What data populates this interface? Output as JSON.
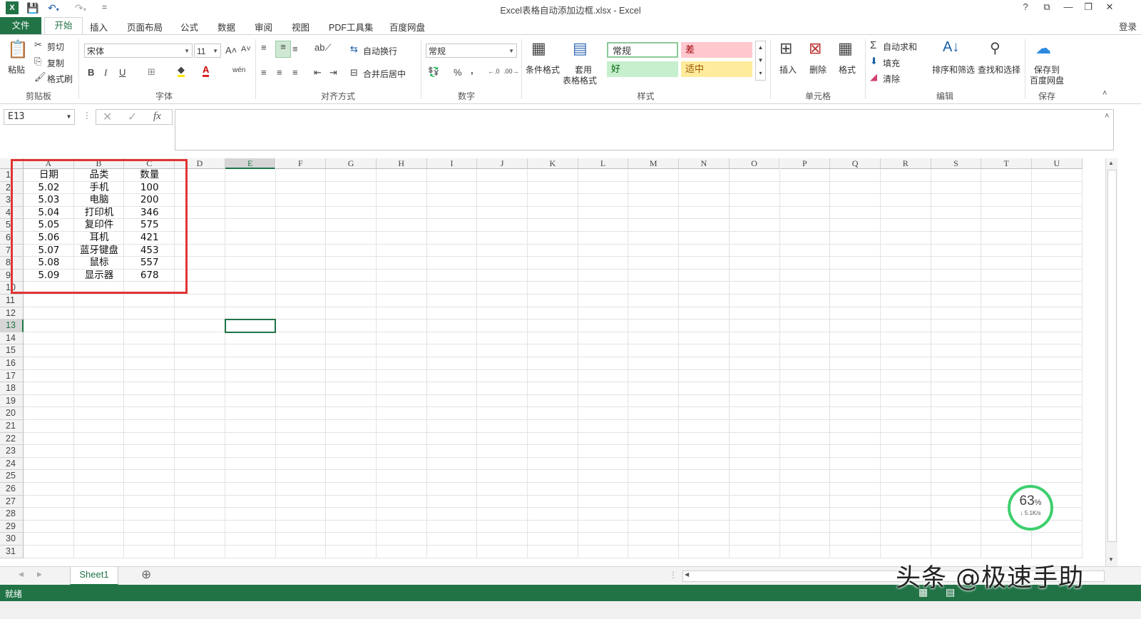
{
  "window": {
    "title": "Excel表格自动添加边框.xlsx - Excel",
    "help": "?",
    "ribbon_opts": "⧉",
    "minimize": "—",
    "restore": "❐",
    "close": "✕"
  },
  "quick_access": {
    "app_icon": "excel-logo-icon",
    "save": "save-icon",
    "undo": "undo-icon",
    "redo": "redo-icon",
    "customize": "="
  },
  "tabs": {
    "file": "文件",
    "items": [
      "开始",
      "插入",
      "页面布局",
      "公式",
      "数据",
      "审阅",
      "视图",
      "PDF工具集",
      "百度网盘"
    ],
    "login": "登录"
  },
  "ribbon": {
    "clipboard": {
      "paste": "粘贴",
      "cut": "剪切",
      "copy": "复制",
      "format_painter": "格式刷",
      "label": "剪贴板"
    },
    "font": {
      "name": "宋体",
      "size": "11",
      "bold": "B",
      "italic": "I",
      "underline": "U",
      "grow": "A˄",
      "shrink": "A˅",
      "wen": "wén",
      "label": "字体"
    },
    "alignment": {
      "wrap": "自动换行",
      "merge": "合并后居中",
      "label": "对齐方式"
    },
    "number": {
      "format": "常规",
      "percent": "%",
      "comma": ",",
      "label": "数字"
    },
    "styles": {
      "conditional": "条件格式",
      "table_format_1": "套用",
      "table_format_2": "表格格式",
      "normal": "常规",
      "bad": "差",
      "good": "好",
      "neutral": "适中",
      "label": "样式"
    },
    "cells": {
      "insert": "插入",
      "delete": "删除",
      "format": "格式",
      "label": "单元格"
    },
    "editing": {
      "autosum": "自动求和",
      "fill": "填充",
      "clear": "清除",
      "sort": "排序和筛选",
      "find": "查找和选择",
      "label": "编辑"
    },
    "save": {
      "line1": "保存到",
      "line2": "百度网盘",
      "label": "保存"
    }
  },
  "formula_bar": {
    "name_box": "E13",
    "fx": "fx",
    "cancel": "✕",
    "enter": "✓",
    "value": ""
  },
  "sheet": {
    "columns": [
      "A",
      "B",
      "C",
      "D",
      "E",
      "F",
      "G",
      "H",
      "I",
      "J",
      "K",
      "L",
      "M",
      "N",
      "O",
      "P",
      "Q",
      "R",
      "S",
      "T",
      "U"
    ],
    "rows": [
      "1",
      "2",
      "3",
      "4",
      "5",
      "6",
      "7",
      "8",
      "9",
      "10",
      "11",
      "12",
      "13",
      "14",
      "15",
      "16",
      "17",
      "18",
      "19",
      "20",
      "21",
      "22",
      "23",
      "24",
      "25",
      "26",
      "27",
      "28",
      "29",
      "30",
      "31"
    ],
    "headers": [
      "日期",
      "品类",
      "数量"
    ],
    "data": [
      [
        "5.02",
        "手机",
        "100"
      ],
      [
        "5.03",
        "电脑",
        "200"
      ],
      [
        "5.04",
        "打印机",
        "346"
      ],
      [
        "5.05",
        "复印件",
        "575"
      ],
      [
        "5.06",
        "耳机",
        "421"
      ],
      [
        "5.07",
        "蓝牙键盘",
        "453"
      ],
      [
        "5.08",
        "鼠标",
        "557"
      ],
      [
        "5.09",
        "显示器",
        "678"
      ]
    ],
    "active_cell": "E13"
  },
  "sheet_tabs": {
    "active": "Sheet1",
    "add": "⊕"
  },
  "status": {
    "text": "就绪"
  },
  "gauge": {
    "percent": "63",
    "unit": "%",
    "speed": "↓ 5.1K/s"
  },
  "watermark": "头条 @极速手助",
  "colors": {
    "excel_green": "#217346",
    "highlight_red": "#e03434",
    "gauge_green": "#3ecf6e"
  }
}
